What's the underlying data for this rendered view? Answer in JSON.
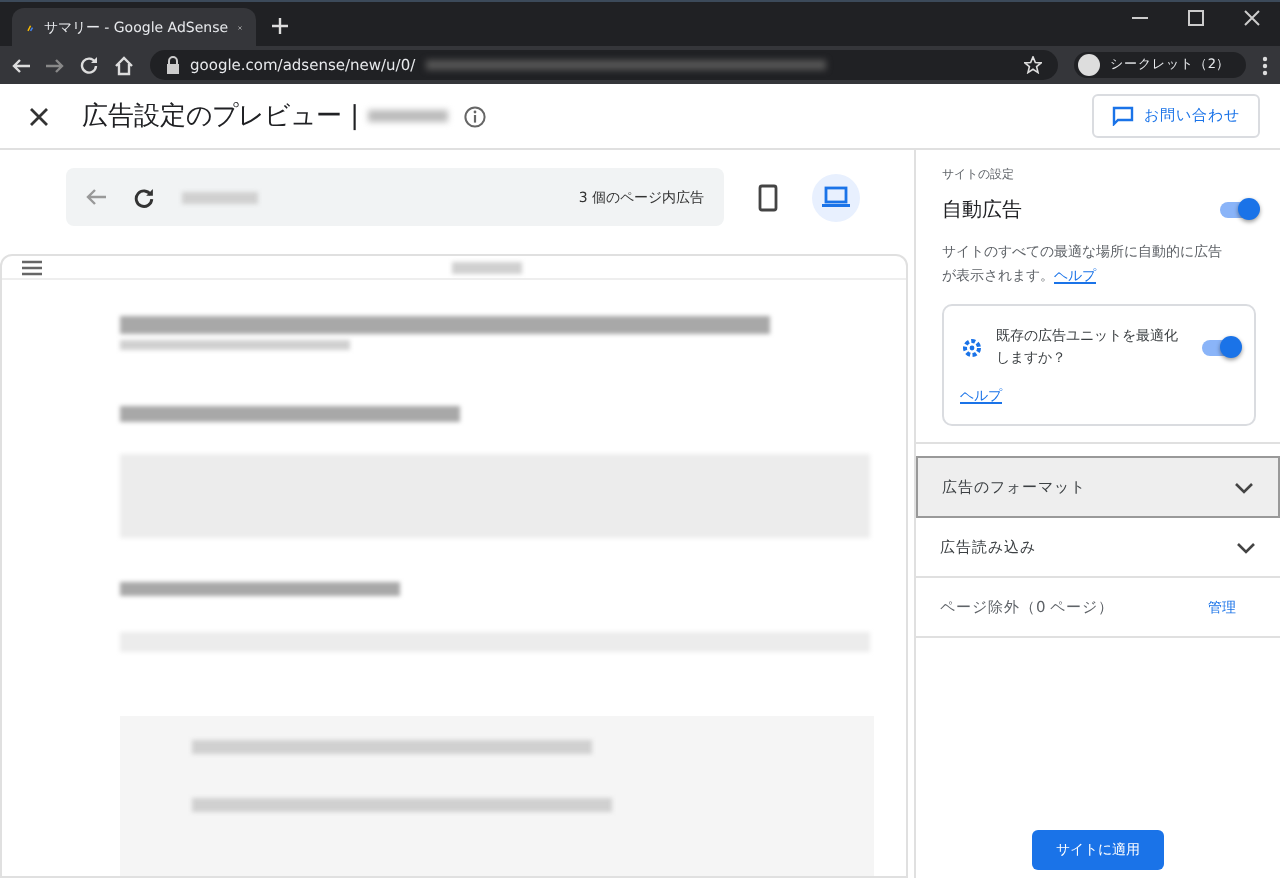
{
  "browser": {
    "tab_title": "サマリー - Google AdSense",
    "url": "google.com/adsense/new/u/0/",
    "profile": "シークレット（2）"
  },
  "header": {
    "title": "広告設定のプレビュー |",
    "contact_button": "お問い合わせ"
  },
  "preview_toolbar": {
    "ad_count": "3 個のページ内広告",
    "devices": [
      {
        "kind": "mobile",
        "selected": false
      },
      {
        "kind": "desktop",
        "selected": true
      }
    ]
  },
  "settings": {
    "section_label": "サイトの設定",
    "auto_ads": {
      "label": "自動広告",
      "on": true,
      "description": "サイトのすべての最適な場所に自動的に広告が表示されます。",
      "help": "ヘルプ"
    },
    "optimize": {
      "label": "既存の広告ユニットを最適化しますか？",
      "on": true,
      "help": "ヘルプ"
    },
    "sections": [
      {
        "label": "広告のフォーマット",
        "selected": true
      },
      {
        "label": "広告読み込み",
        "selected": false
      }
    ],
    "exclusions": {
      "label": "ページ除外（0 ページ）",
      "link": "管理"
    },
    "apply_button": "サイトに適用"
  }
}
